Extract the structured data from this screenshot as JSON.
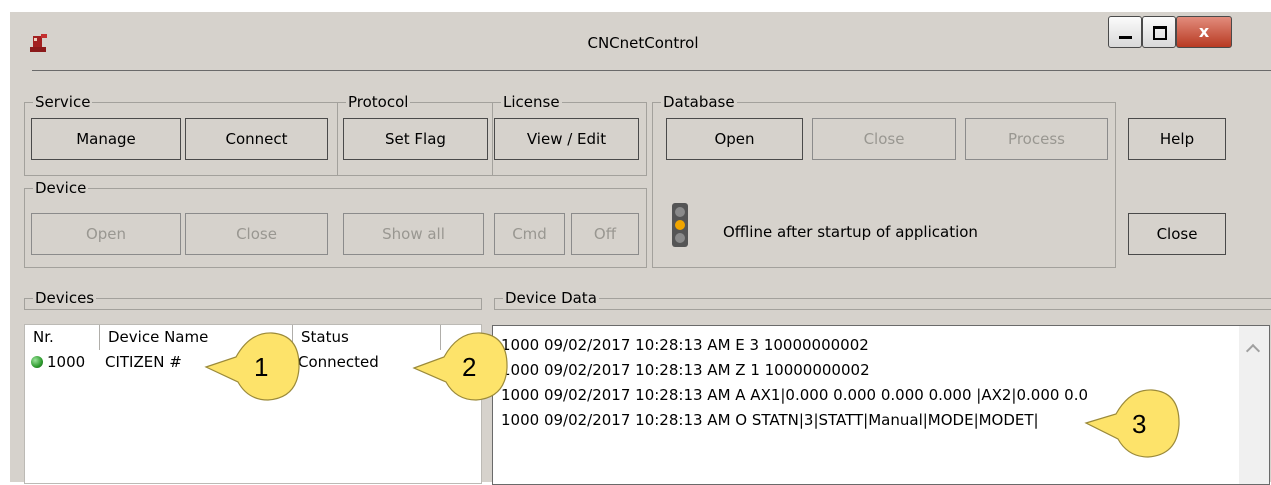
{
  "window": {
    "title": "CNCnetControl",
    "minimize_glyph": "▁",
    "maximize_glyph": "□",
    "close_glyph": "x"
  },
  "groups": {
    "service": {
      "label": "Service",
      "buttons": [
        "Manage",
        "Connect"
      ]
    },
    "protocol": {
      "label": "Protocol",
      "buttons": [
        "Set Flag"
      ]
    },
    "license": {
      "label": "License",
      "buttons": [
        "View / Edit"
      ]
    },
    "database": {
      "label": "Database",
      "buttons": [
        "Open",
        "Close",
        "Process"
      ]
    },
    "device": {
      "label": "Device",
      "buttons": [
        "Open",
        "Close",
        "Show all",
        "Cmd",
        "Off"
      ]
    }
  },
  "side_buttons": {
    "help": "Help",
    "close": "Close"
  },
  "status": {
    "message": "Offline after startup of application"
  },
  "devices": {
    "label": "Devices",
    "columns": [
      "Nr.",
      "Device Name",
      "Status"
    ],
    "rows": [
      {
        "nr": "1000",
        "name": "CITIZEN #",
        "status": "Connected",
        "status_color": "#2e9b2e"
      }
    ]
  },
  "device_data": {
    "label": "Device Data",
    "lines": [
      "1000 09/02/2017 10:28:13 AM E 3 10000000002",
      "1000 09/02/2017 10:28:13 AM Z 1 10000000002",
      "1000 09/02/2017 10:28:13 AM A AX1|0.000 0.000 0.000 0.000 |AX2|0.000 0.0",
      "1000 09/02/2017 10:28:13 AM O STATN|3|STATT|Manual|MODE|MODET|"
    ]
  },
  "callouts": [
    "1",
    "2",
    "3"
  ],
  "colors": {
    "window_bg": "#d6d2cc",
    "callout_fill": "#fde36a",
    "close_button": "#c2452e"
  }
}
